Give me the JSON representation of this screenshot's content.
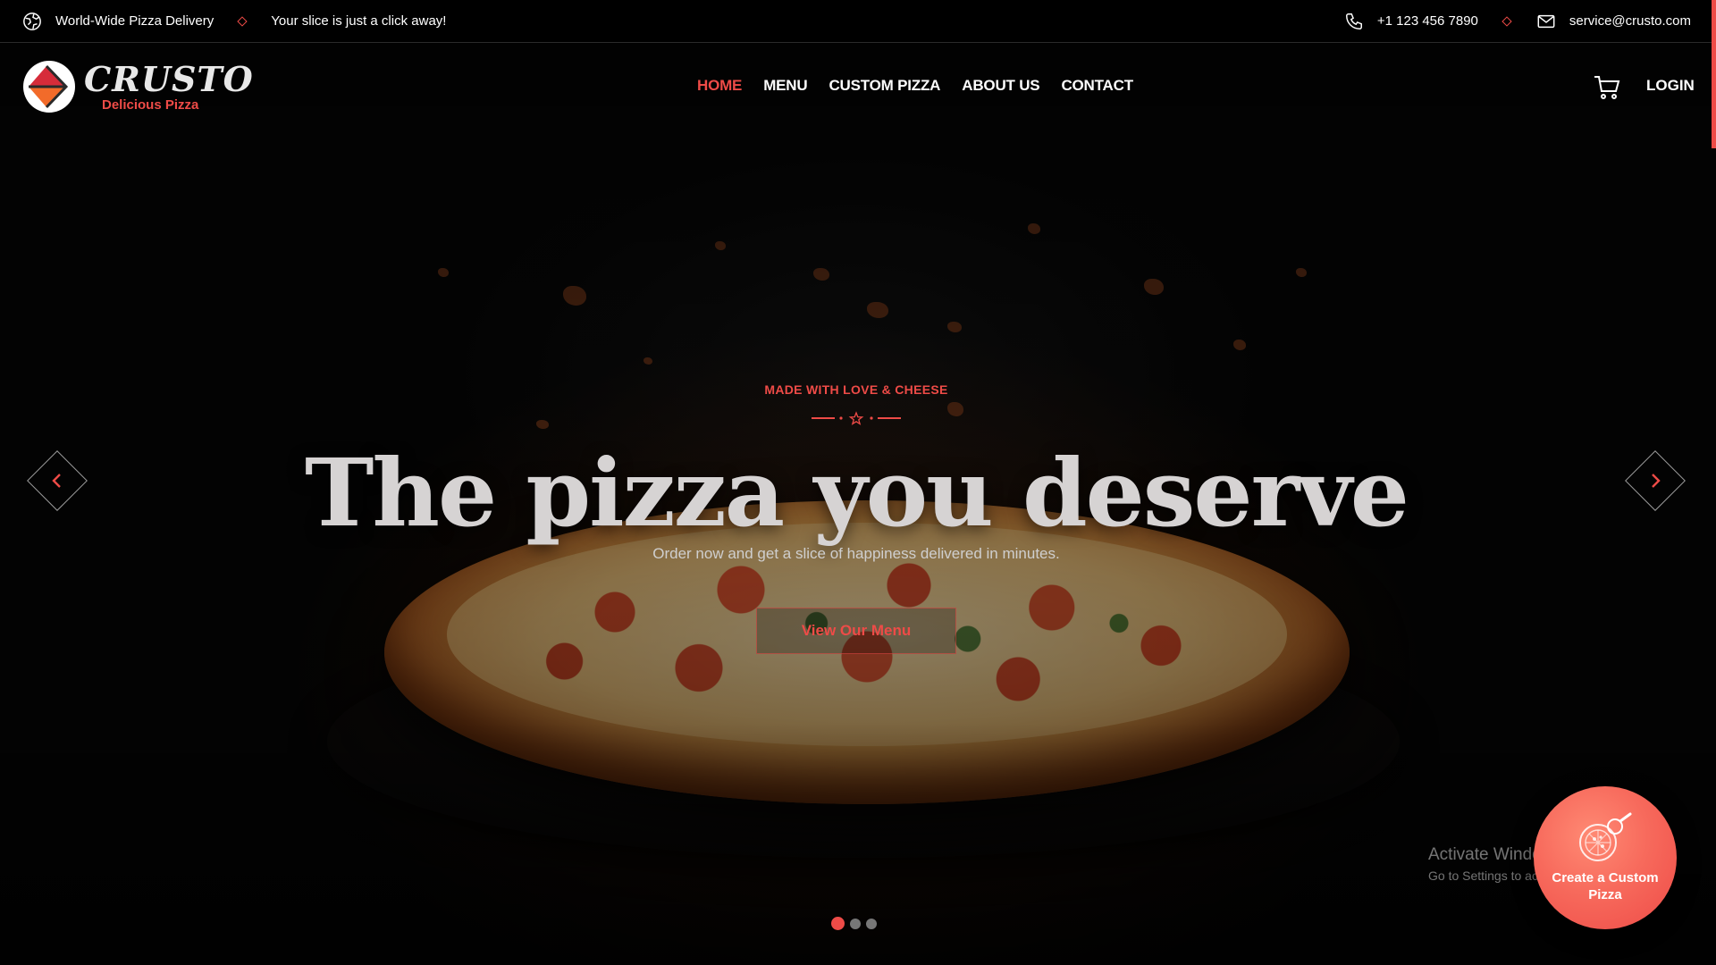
{
  "topbar": {
    "delivery_text": "World-Wide Pizza Delivery",
    "tagline": "Your slice is just a click away!",
    "phone": "+1 123 456 7890",
    "email": "service@crusto.com"
  },
  "brand": {
    "name": "CRUSTO",
    "tagline": "Delicious Pizza",
    "accent_color": "#ee4b47"
  },
  "nav": {
    "items": [
      {
        "label": "HOME",
        "active": true
      },
      {
        "label": "MENU",
        "active": false
      },
      {
        "label": "CUSTOM PIZZA",
        "active": false
      },
      {
        "label": "ABOUT US",
        "active": false
      },
      {
        "label": "CONTACT",
        "active": false
      }
    ],
    "cart_icon": "cart-icon",
    "login_label": "LOGIN"
  },
  "hero": {
    "eyebrow": "MADE WITH LOVE & CHEESE",
    "title": "The pizza you deserve",
    "subtitle": "Order now and get a slice of happiness delivered in minutes.",
    "cta_label": "View Our Menu",
    "slides_total": 3,
    "active_slide": 1
  },
  "fab": {
    "label": "Create a Custom Pizza",
    "icon": "pizza-cutter-icon"
  },
  "watermark": {
    "title": "Activate Windows",
    "subtitle": "Go to Settings to activate Windows."
  }
}
